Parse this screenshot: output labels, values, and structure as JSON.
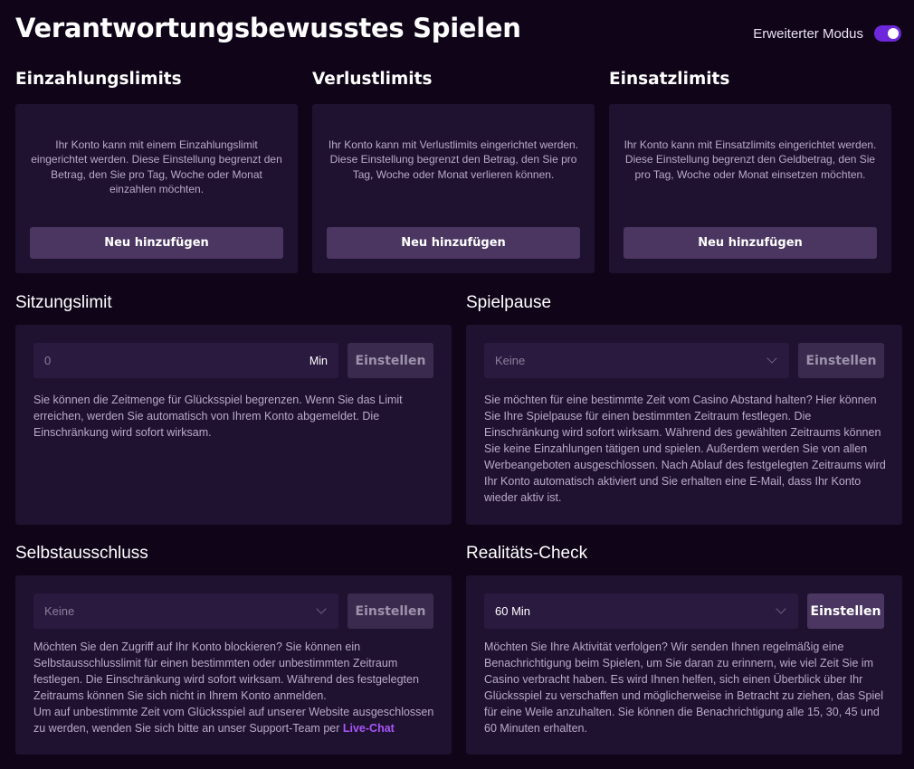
{
  "header": {
    "title": "Verantwortungsbewusstes Spielen",
    "mode_label": "Erweiterter Modus",
    "mode_enabled": true
  },
  "limits": [
    {
      "title": "Einzahlungslimits",
      "text": "Ihr Konto kann mit einem Einzahlungslimit eingerichtet werden. Diese Einstellung begrenzt den Betrag, den Sie pro Tag, Woche oder Monat einzahlen möchten.",
      "button": "Neu hinzufügen"
    },
    {
      "title": "Verlustlimits",
      "text": "Ihr Konto kann mit Verlustlimits eingerichtet werden. Diese Einstellung begrenzt den Betrag, den Sie pro Tag, Woche oder Monat verlieren können.",
      "button": "Neu hinzufügen"
    },
    {
      "title": "Einsatzlimits",
      "text": "Ihr Konto kann mit Einsatzlimits eingerichtet werden. Diese Einstellung begrenzt den Geldbetrag, den Sie pro Tag, Woche oder Monat einsetzen möchten.",
      "button": "Neu hinzufügen"
    }
  ],
  "session": {
    "title": "Sitzungslimit",
    "input_value": "0",
    "unit": "Min",
    "button": "Einstellen",
    "text": "Sie können die Zeitmenge für Glücksspiel begrenzen. Wenn Sie das Limit erreichen, werden Sie automatisch von Ihrem Konto abgemeldet. Die Einschränkung wird sofort wirksam."
  },
  "pause": {
    "title": "Spielpause",
    "select_value": "Keine",
    "button": "Einstellen",
    "text": "Sie möchten für eine bestimmte Zeit vom Casino Abstand halten? Hier können Sie Ihre Spielpause für einen bestimmten Zeitraum festlegen. Die Einschränkung wird sofort wirksam. Während des gewählten Zeitraums können Sie keine Einzahlungen tätigen und spielen. Außerdem werden Sie von allen Werbeangeboten ausgeschlossen. Nach Ablauf des festgelegten Zeitraums wird Ihr Konto automatisch aktiviert und Sie erhalten eine E-Mail, dass Ihr Konto wieder aktiv ist."
  },
  "exclusion": {
    "title": "Selbstausschluss",
    "select_value": "Keine",
    "button": "Einstellen",
    "text1": "Möchten Sie den Zugriff auf Ihr Konto blockieren? Sie können ein Selbstausschlusslimit für einen bestimmten oder unbestimmten Zeitraum festlegen. Die Einschränkung wird sofort wirksam. Während des festgelegten Zeitraums können Sie sich nicht in Ihrem Konto anmelden.",
    "text2": "Um auf unbestimmte Zeit vom Glücksspiel auf unserer Website ausgeschlossen zu werden, wenden Sie sich bitte an unser Support-Team per",
    "link": "Live-Chat"
  },
  "reality": {
    "title": "Realitäts-Check",
    "select_value": "60 Min",
    "button": "Einstellen",
    "text": "Möchten Sie Ihre Aktivität verfolgen? Wir senden Ihnen regelmäßig eine Benachrichtigung beim Spielen, um Sie daran zu erinnern, wie viel Zeit Sie im Casino verbracht haben. Es wird Ihnen helfen, sich einen Überblick über Ihr Glücksspiel zu verschaffen und möglicherweise in Betracht zu ziehen, das Spiel für eine Weile anzuhalten. Sie können die Benachrichtigung alle 15, 30, 45 und 60 Minuten erhalten."
  },
  "colors": {
    "background": "#0f0418",
    "card": "#1f1230",
    "button": "#4a3660",
    "accent": "#6d28d9",
    "link": "#a855f7"
  }
}
